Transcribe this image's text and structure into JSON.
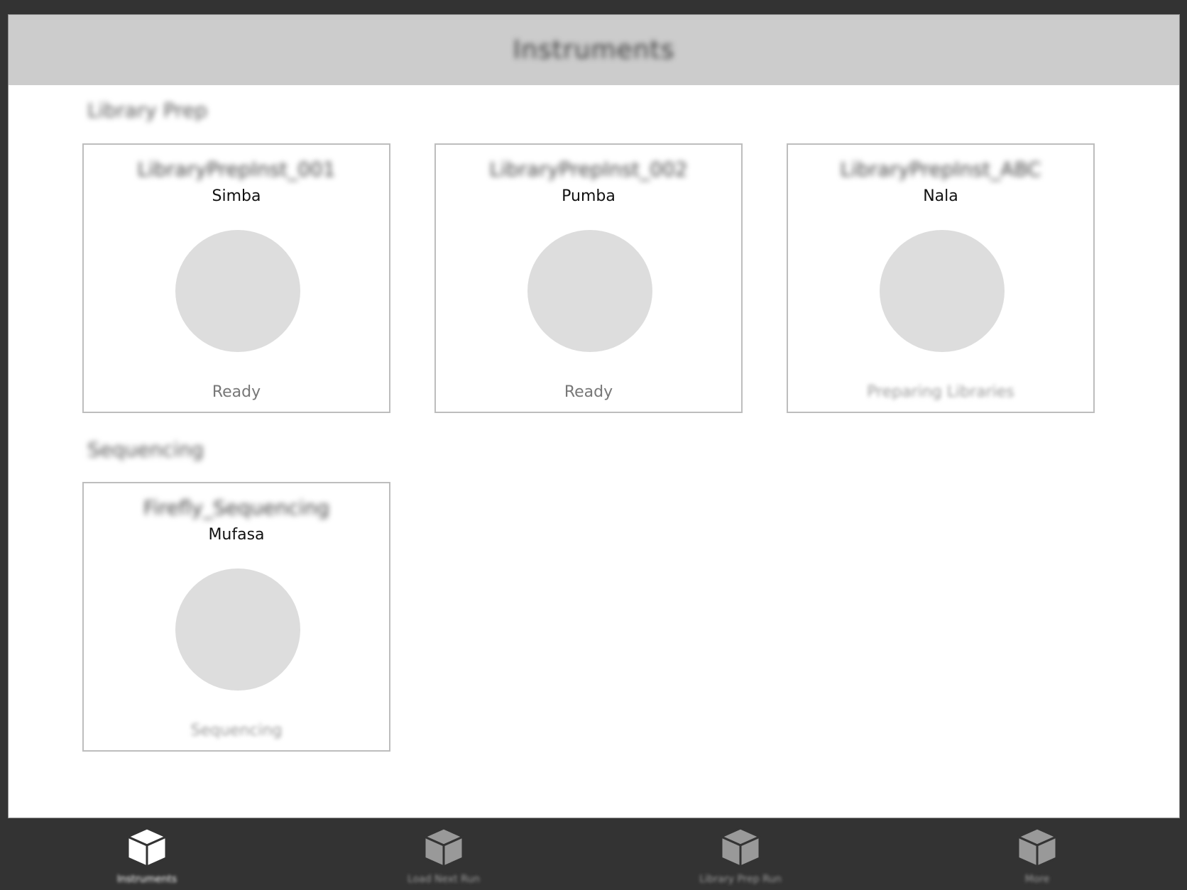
{
  "app": {
    "title": "Instruments"
  },
  "sections": [
    {
      "label": "Library Prep",
      "cards": [
        {
          "title": "LibraryPrepInst_001",
          "nickname": "Simba",
          "status": "Ready"
        },
        {
          "title": "LibraryPrepInst_002",
          "nickname": "Pumba",
          "status": "Ready"
        },
        {
          "title": "LibraryPrepInst_ABC",
          "nickname": "Nala",
          "status": "Preparing Libraries"
        }
      ]
    },
    {
      "label": "Sequencing",
      "cards": [
        {
          "title": "Firefly_Sequencing",
          "nickname": "Mufasa",
          "status": "Sequencing"
        }
      ]
    }
  ],
  "tabbar": {
    "items": [
      {
        "label": "Instruments",
        "icon": "cube-icon",
        "active": true
      },
      {
        "label": "Load Next Run",
        "icon": "cube-icon",
        "active": false
      },
      {
        "label": "Library Prep Run",
        "icon": "cube-icon",
        "active": false
      },
      {
        "label": "More",
        "icon": "cube-icon",
        "active": false
      }
    ]
  },
  "colors": {
    "background": "#333333",
    "titlebar": "#cccccc",
    "card_border": "#bdbdbd",
    "status_circle": "#dddddd",
    "tab_active_icon": "#ffffff",
    "tab_inactive_icon": "#999999"
  }
}
